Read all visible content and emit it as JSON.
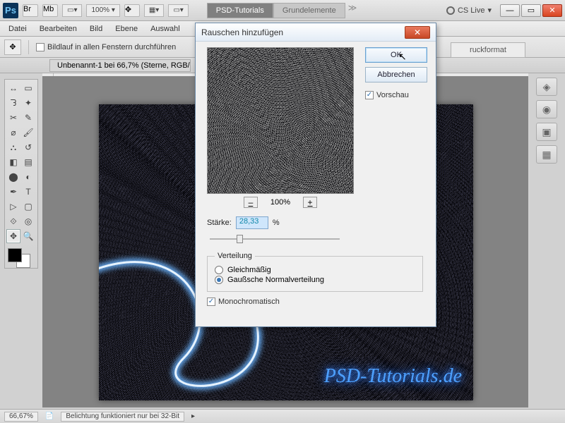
{
  "app": {
    "zoom": "100%",
    "workspace_tabs": [
      "PSD-Tutorials",
      "Grundelemente"
    ],
    "active_workspace": 0,
    "cs_live": "CS Live"
  },
  "menu": [
    "Datei",
    "Bearbeiten",
    "Bild",
    "Ebene",
    "Auswahl"
  ],
  "options": {
    "scroll_all": "Bildlauf in allen Fenstern durchführen"
  },
  "right_tab": "ruckformat",
  "document": {
    "tab": "Unbenannt-1 bei 66,7% (Sterne, RGB/…",
    "watermark": "PSD-Tutorials.de"
  },
  "dialog": {
    "title": "Rauschen hinzufügen",
    "ok": "OK",
    "cancel": "Abbrechen",
    "preview_label": "Vorschau",
    "zoom_label": "100%",
    "strength_label": "Stärke:",
    "strength_value": "28,33",
    "strength_unit": "%",
    "dist_legend": "Verteilung",
    "dist_uniform": "Gleichmäßig",
    "dist_gauss": "Gaußsche Normalverteilung",
    "mono": "Monochromatisch"
  },
  "status": {
    "zoom": "66,67%",
    "msg": "Belichtung funktioniert nur bei 32-Bit"
  }
}
